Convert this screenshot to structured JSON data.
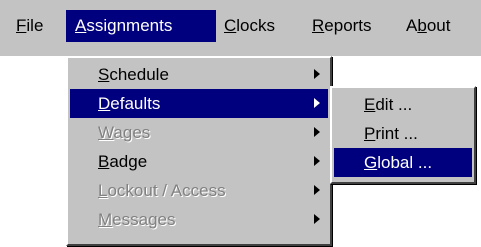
{
  "menubar": {
    "items": [
      {
        "mnemonic": "F",
        "rest": "ile"
      },
      {
        "mnemonic": "A",
        "rest": "ssignments"
      },
      {
        "mnemonic": "C",
        "rest": "locks"
      },
      {
        "mnemonic": "R",
        "rest": "eports"
      },
      {
        "pre": "A",
        "mnemonic": "b",
        "rest": "out"
      }
    ]
  },
  "assignments_menu": {
    "items": [
      {
        "mnemonic": "S",
        "rest": "chedule"
      },
      {
        "mnemonic": "D",
        "rest": "efaults"
      },
      {
        "mnemonic": "W",
        "rest": "ages"
      },
      {
        "mnemonic": "B",
        "rest": "adge"
      },
      {
        "mnemonic": "L",
        "rest": "ockout / Access"
      },
      {
        "mnemonic": "M",
        "rest": "essages"
      }
    ]
  },
  "defaults_submenu": {
    "items": [
      {
        "mnemonic": "E",
        "rest": "dit ..."
      },
      {
        "mnemonic": "P",
        "rest": "rint ..."
      },
      {
        "mnemonic": "G",
        "rest": "lobal ..."
      }
    ]
  },
  "colors": {
    "menu_face": "#c3c3c3",
    "highlight": "#00007f",
    "disabled_text": "#818181"
  }
}
